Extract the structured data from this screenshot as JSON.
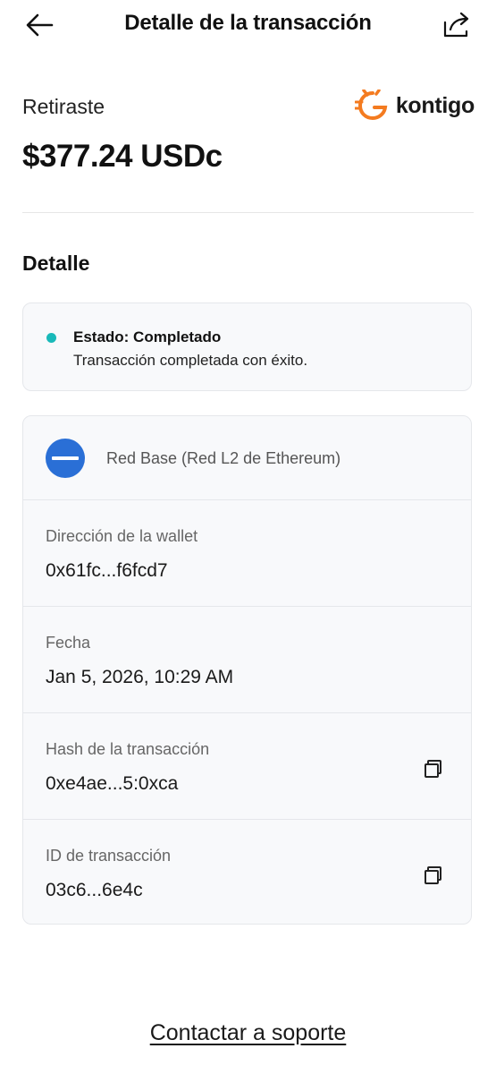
{
  "header": {
    "title": "Detalle de la transacción",
    "back_icon": "arrow-left-icon",
    "share_icon": "share-icon"
  },
  "summary": {
    "label": "Retiraste",
    "amount": "$377.24 USDc"
  },
  "brand": {
    "name": "kontigo",
    "logo_color": "#f47b20"
  },
  "detail_section": {
    "title": "Detalle"
  },
  "status": {
    "title": "Estado: Completado",
    "description": "Transacción completada con éxito.",
    "dot_color": "#19b9b9"
  },
  "details": {
    "network": {
      "label": "Red Base (Red L2 de Ethereum)",
      "icon": "base-network-icon",
      "icon_color": "#2a6fd6"
    },
    "wallet": {
      "label": "Dirección de la wallet",
      "value": "0x61fc...f6fcd7"
    },
    "date": {
      "label": "Fecha",
      "value": "Jan 5, 2026, 10:29 AM"
    },
    "hash": {
      "label": "Hash de la transacción",
      "value": "0xe4ae...5:0xca",
      "copy_icon": "copy-icon"
    },
    "transaction_id": {
      "label": "ID de transacción",
      "value": "03c6...6e4c",
      "copy_icon": "copy-icon"
    }
  },
  "footer": {
    "support_link": "Contactar a soporte"
  }
}
